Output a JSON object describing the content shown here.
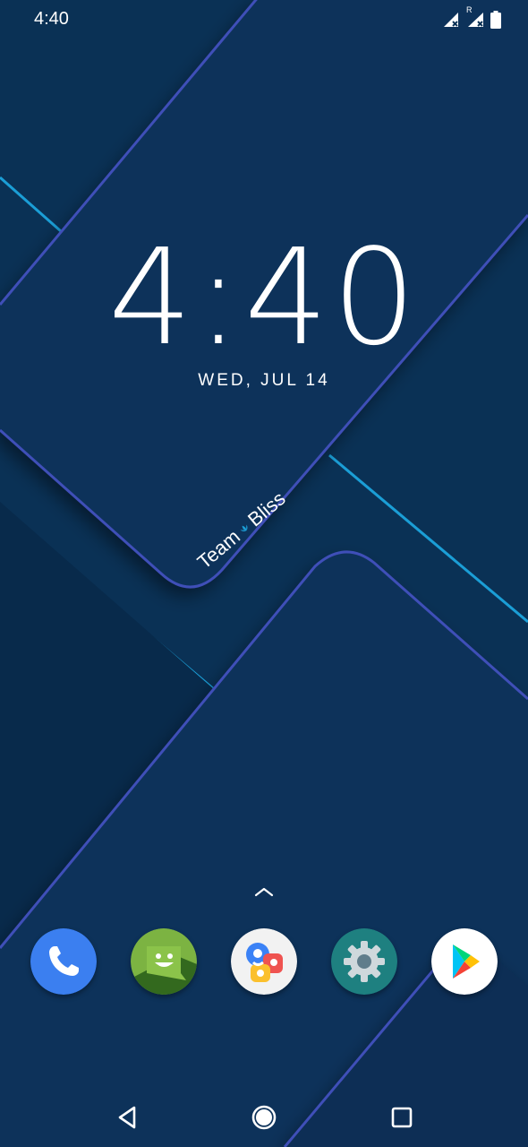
{
  "status_bar": {
    "time": "4:40",
    "icons": [
      "signal-no-service-icon",
      "signal-roaming-no-service-icon",
      "battery-icon"
    ],
    "roaming_label": "R"
  },
  "lockscreen": {
    "clock": "4:40",
    "date": "WED, JUL 14"
  },
  "wallpaper": {
    "brand_text_1": "Team",
    "brand_text_2": "Bliss",
    "colors": {
      "background": "#0a3155",
      "edge_blue": "#3f4fb8",
      "edge_cyan": "#1b9ed6"
    }
  },
  "dock": {
    "apps": [
      {
        "name": "Phone",
        "icon": "phone-icon",
        "color": "#3b7ff0"
      },
      {
        "name": "Messaging",
        "icon": "messaging-icon",
        "color": "#7cb342"
      },
      {
        "name": "Contacts",
        "icon": "contacts-icon",
        "color": "#f2f2f2"
      },
      {
        "name": "Settings",
        "icon": "settings-icon",
        "color": "#1e8080"
      },
      {
        "name": "Play Store",
        "icon": "play-store-icon",
        "color": "#ffffff"
      }
    ]
  },
  "navigation": {
    "buttons": [
      "back",
      "home",
      "recents"
    ]
  }
}
